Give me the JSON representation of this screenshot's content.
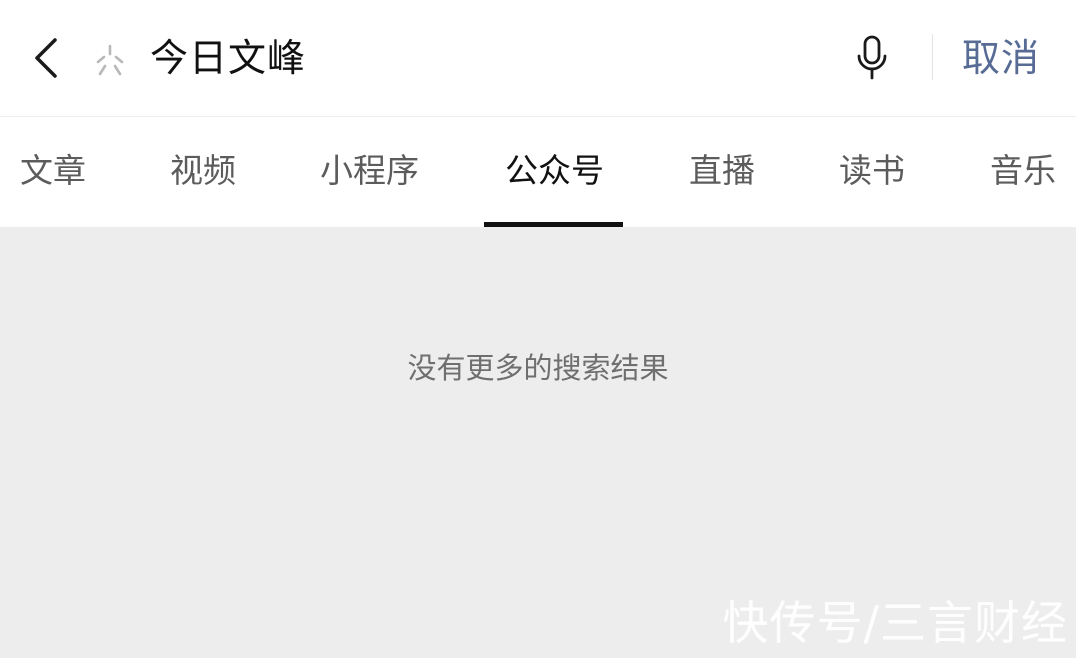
{
  "search": {
    "query": "今日文峰",
    "cancel_label": "取消"
  },
  "tabs": [
    {
      "label": "文章",
      "active": false
    },
    {
      "label": "视频",
      "active": false
    },
    {
      "label": "小程序",
      "active": false
    },
    {
      "label": "公众号",
      "active": true
    },
    {
      "label": "直播",
      "active": false
    },
    {
      "label": "读书",
      "active": false
    },
    {
      "label": "音乐",
      "active": false
    }
  ],
  "results": {
    "empty_message": "没有更多的搜索结果"
  },
  "watermark": "快传号/三言财经",
  "colors": {
    "accent": "#576b95",
    "active_tab": "#111111",
    "inactive_tab": "#5c5c5c",
    "background": "#ededed",
    "surface": "#ffffff"
  },
  "icons": {
    "back": "chevron-left-icon",
    "cursor": "loading-spinner-icon",
    "voice": "microphone-icon"
  }
}
